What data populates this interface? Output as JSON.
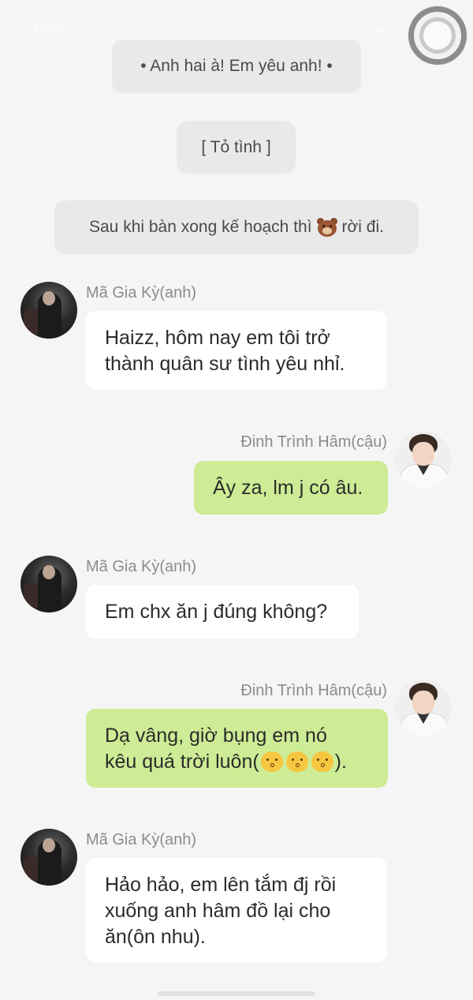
{
  "status_bar": {
    "time": "15:00",
    "signal": "4G"
  },
  "system_messages": [
    {
      "text": "• Anh hai à! Em yêu anh! •"
    },
    {
      "text": "[ Tỏ tình ]"
    },
    {
      "text_before": "Sau khi bàn xong kế hoạch thì",
      "icon": "bear-icon",
      "text_after": "rời đi."
    }
  ],
  "messages": [
    {
      "sender": "Mã Gia Kỳ(anh)",
      "side": "left",
      "lines": [
        "Haizz, hôm nay em tôi trở",
        "thành quân sư tình yêu nhỉ."
      ]
    },
    {
      "sender": "Đinh Trình Hâm(cậu)",
      "side": "right",
      "lines": [
        "Ây za, lm j có âu."
      ]
    },
    {
      "sender": "Mã Gia Kỳ(anh)",
      "side": "left",
      "lines": [
        "Em chx ăn j đúng không?"
      ]
    },
    {
      "sender": "Đinh Trình Hâm(cậu)",
      "side": "right",
      "lines": [
        "Dạ vâng, giờ bụng em nó",
        "kêu quá trời luôn("
      ],
      "line_end": ").",
      "emoji": "kissing-face-icon",
      "emoji_count": 3
    },
    {
      "sender": "Mã Gia Kỳ(anh)",
      "side": "left",
      "lines": [
        "Hảo hảo, em lên tắm đj rồi",
        "xuống anh hâm đồ lại cho",
        "ăn(ôn nhu)."
      ]
    }
  ],
  "colors": {
    "background": "#f5f5f5",
    "system_bubble": "#e9e9e9",
    "incoming_bubble": "#ffffff",
    "outgoing_bubble": "#cdec95",
    "name_text": "#8c8c8c"
  }
}
